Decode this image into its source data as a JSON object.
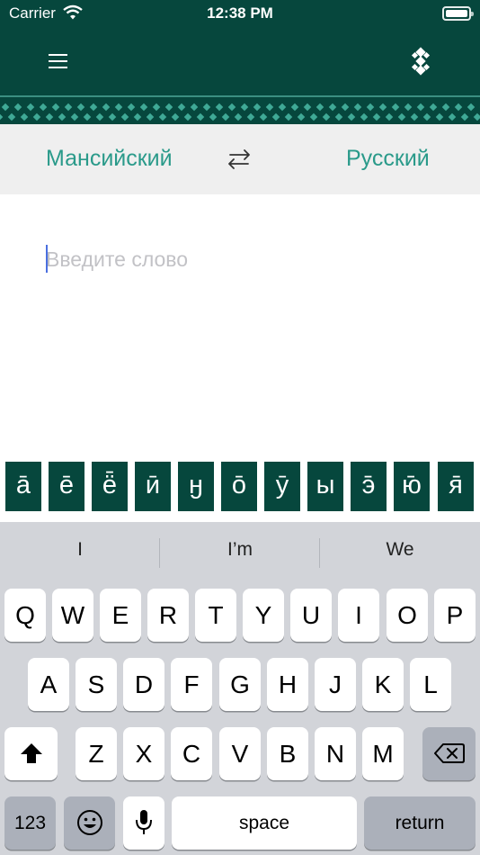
{
  "status_bar": {
    "carrier": "Carrier",
    "time": "12:38 PM"
  },
  "header": {
    "menu_icon": "hamburger-menu-icon",
    "logo_icon": "ornament-logo-icon"
  },
  "language_bar": {
    "source_language": "Мансийский",
    "target_language": "Русский",
    "swap_icon": "swap-arrows-icon"
  },
  "search": {
    "placeholder": "Введите слово",
    "value": ""
  },
  "special_characters": [
    "ā",
    "ē",
    "ё̄",
    "ӣ",
    "ӈ",
    "ō",
    "ӯ",
    "ы",
    "э̄",
    "ю̄",
    "я̄"
  ],
  "keyboard": {
    "suggestions": [
      "I",
      "I’m",
      "We"
    ],
    "rows": [
      [
        "Q",
        "W",
        "E",
        "R",
        "T",
        "Y",
        "U",
        "I",
        "O",
        "P"
      ],
      [
        "A",
        "S",
        "D",
        "F",
        "G",
        "H",
        "J",
        "K",
        "L"
      ],
      [
        "Z",
        "X",
        "C",
        "V",
        "B",
        "N",
        "M"
      ]
    ],
    "numbers_label": "123",
    "space_label": "space",
    "return_label": "return",
    "shift_icon": "shift-arrow-icon",
    "backspace_icon": "backspace-icon",
    "emoji_icon": "emoji-icon",
    "mic_icon": "microphone-icon"
  },
  "colors": {
    "primary": "#06473d",
    "accent": "#2a9a8a",
    "language_bar": "#efefef",
    "keyboard": "#d2d4d9"
  }
}
